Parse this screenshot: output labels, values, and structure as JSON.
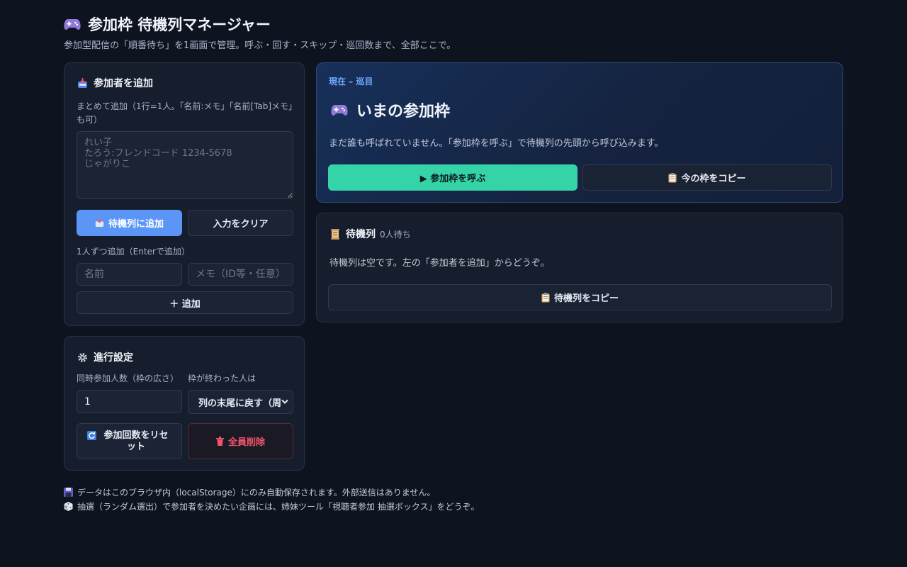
{
  "header": {
    "title": "参加枠 待機列マネージャー",
    "subtitle": "参加型配信の「順番待ち」を1画面で管理。呼ぶ・回す・スキップ・巡回数まで、全部ここで。"
  },
  "add_panel": {
    "title": "参加者を追加",
    "bulk_label": "まとめて追加（1行=1人。「名前:メモ」「名前[Tab]メモ」も可）",
    "bulk_placeholder": "れい子\nたろう:フレンドコード 1234-5678\nじゃがりこ",
    "add_to_queue": "待機列に追加",
    "clear_input": "入力をクリア",
    "single_label": "1人ずつ追加（Enterで追加）",
    "name_placeholder": "名前",
    "memo_placeholder": "メモ（ID等・任意）",
    "add_single": "＋ 追加"
  },
  "settings_panel": {
    "title": "進行設定",
    "slots_label": "同時参加人数（枠の広さ）",
    "slots_value": "1",
    "after_label": "枠が終わった人は",
    "after_selected": "列の末尾に戻す（周回）",
    "reset_count": "参加回数をリセット",
    "delete_all": "全員削除"
  },
  "now_panel": {
    "status": "現在 – 巡目",
    "title": "いまの参加枠",
    "empty_message": "まだ誰も呼ばれていません。「参加枠を呼ぶ」で待機列の先頭から呼び込みます。",
    "call_button": "▶ 参加枠を呼ぶ",
    "copy_button": "今の枠をコピー"
  },
  "queue_panel": {
    "title": "待機列",
    "count": "0人待ち",
    "empty_message": "待機列は空です。左の「参加者を追加」からどうぞ。",
    "copy_button": "待機列をコピー"
  },
  "footer": {
    "note1": "データはこのブラウザ内（localStorage）にのみ自動保存されます。外部送信はありません。",
    "note2": "抽選（ランダム選出）で参加者を決めたい企画には、姉妹ツール「視聴者参加 抽選ボックス」をどうぞ。"
  },
  "colors": {
    "background": "#0e1320",
    "accent_blue": "#5b95f6",
    "accent_green": "#34d3a8",
    "danger": "#f0566a"
  },
  "icons": {
    "title": "gamepad-icon",
    "add": "inbox-tray-icon",
    "settings": "gear-icon",
    "queue": "scroll-icon",
    "copy": "clipboard-icon",
    "reset": "refresh-icon",
    "delete": "trash-icon",
    "save": "floppy-icon",
    "dice": "dice-icon"
  }
}
